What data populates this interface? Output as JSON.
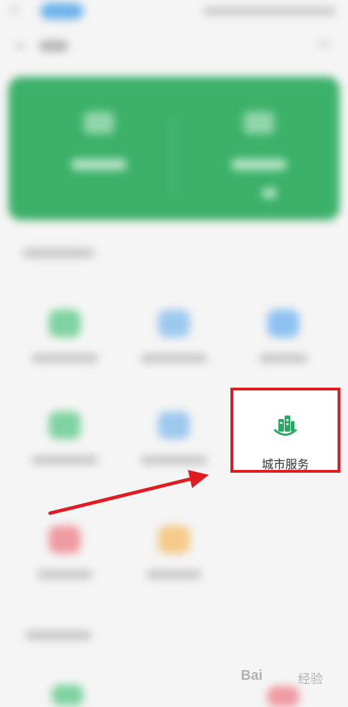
{
  "service_tiles": {
    "city_services": {
      "label": "城市服务",
      "icon": "city-buildings-icon",
      "color": "#2aa860"
    }
  },
  "annotation": {
    "highlight_color": "#e01c23",
    "arrow_color": "#e01c23"
  },
  "watermark": {
    "logo_text": "Bai",
    "cn_text": "经验"
  },
  "colors": {
    "banner_green": "#3cb16a",
    "page_bg": "#f5f5f5"
  }
}
